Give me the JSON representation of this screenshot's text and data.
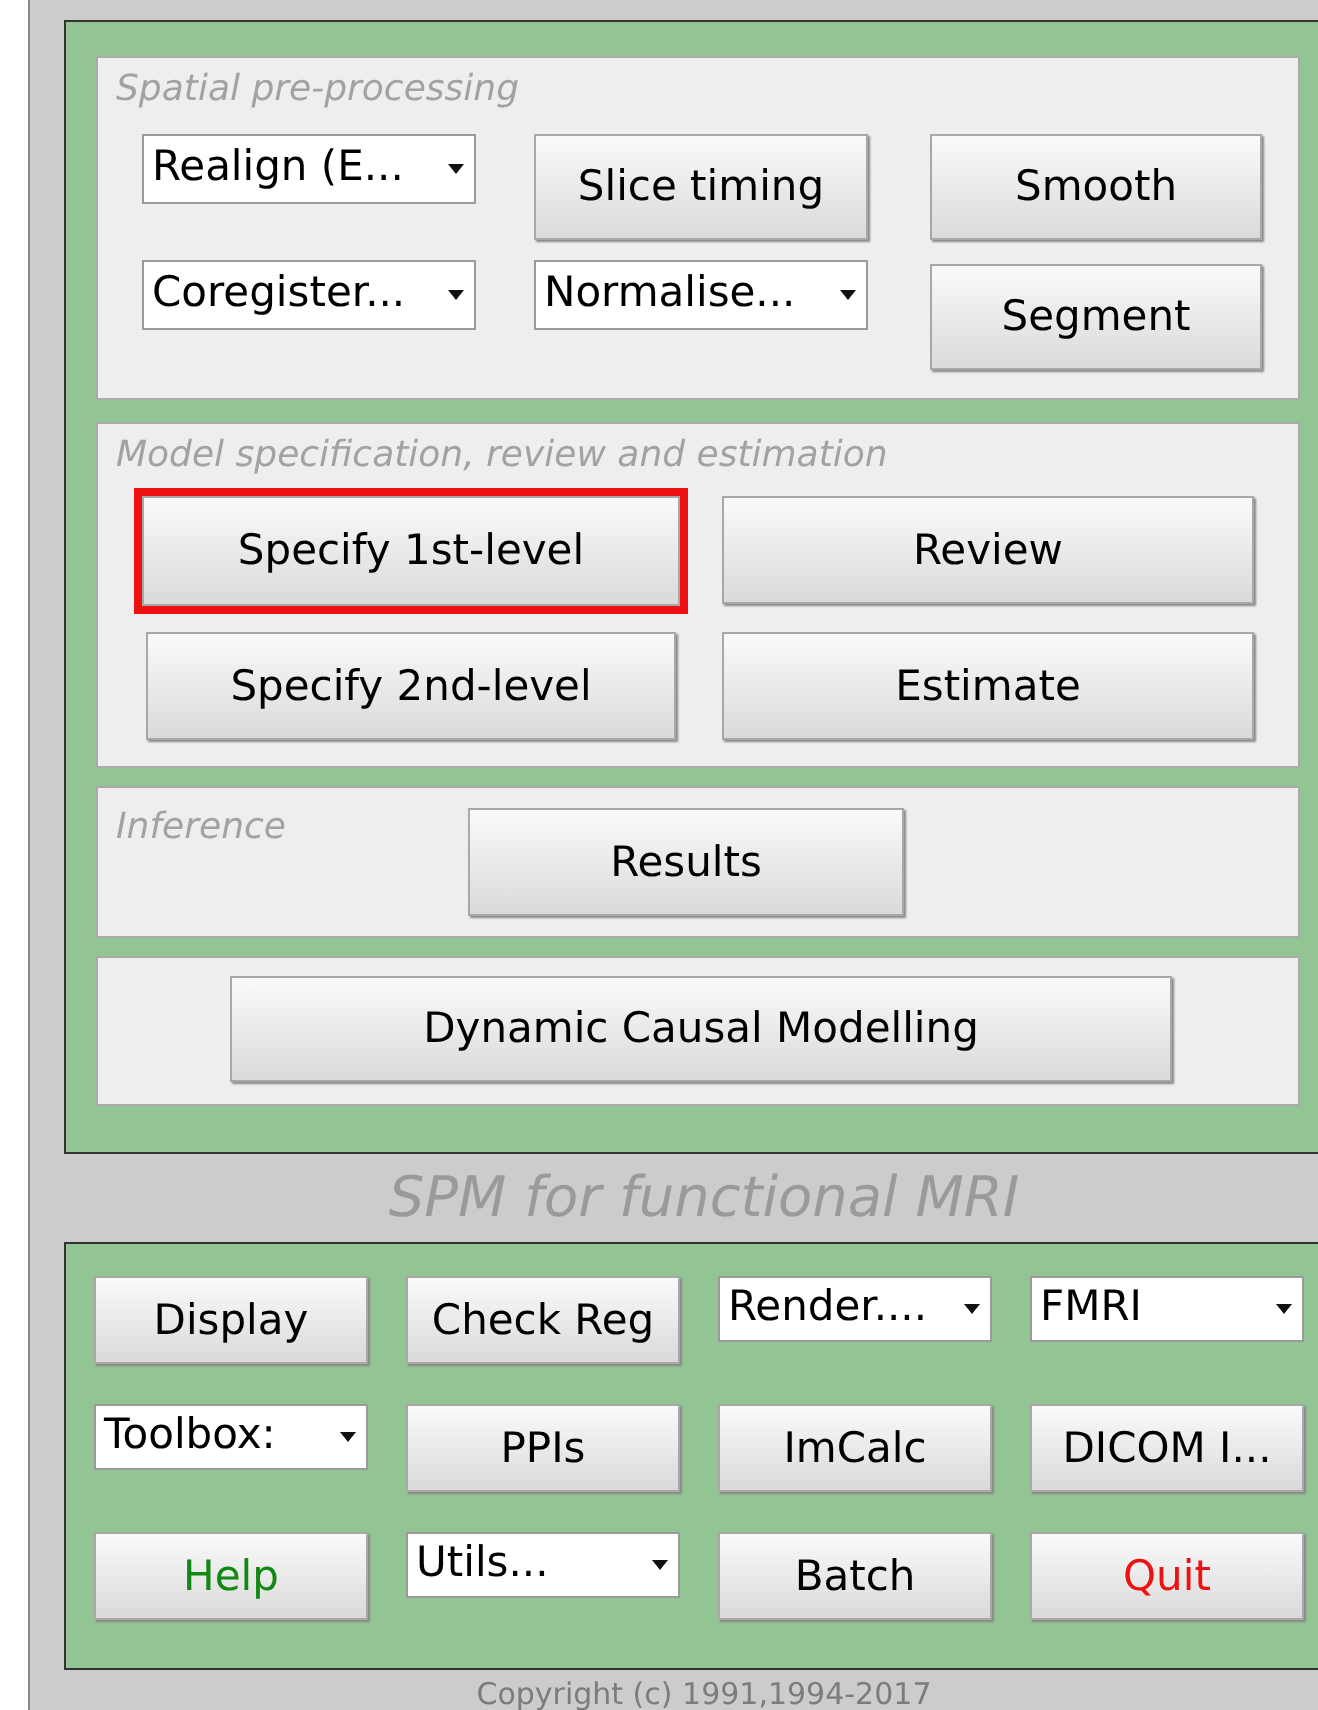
{
  "top_panel": {
    "sections": [
      {
        "title": "Spatial pre-processing",
        "controls": [
          {
            "kind": "dropdown",
            "label": "Realign (E...",
            "highlighted": false
          },
          {
            "kind": "button",
            "label": "Slice timing",
            "highlighted": false
          },
          {
            "kind": "button",
            "label": "Smooth",
            "highlighted": false
          },
          {
            "kind": "dropdown",
            "label": "Coregister...",
            "highlighted": false
          },
          {
            "kind": "dropdown",
            "label": "Normalise...",
            "highlighted": false
          },
          {
            "kind": "button",
            "label": "Segment",
            "highlighted": false
          }
        ]
      },
      {
        "title": "Model specification, review and estimation",
        "controls": [
          {
            "kind": "button",
            "label": "Specify 1st-level",
            "highlighted": true
          },
          {
            "kind": "button",
            "label": "Review",
            "highlighted": false
          },
          {
            "kind": "button",
            "label": "Specify 2nd-level",
            "highlighted": false
          },
          {
            "kind": "button",
            "label": "Estimate",
            "highlighted": false
          }
        ]
      },
      {
        "title": "Inference",
        "controls": [
          {
            "kind": "button",
            "label": "Results",
            "highlighted": false
          }
        ]
      },
      {
        "controls": [
          {
            "kind": "button",
            "label": "Dynamic Causal Modelling",
            "highlighted": false
          }
        ]
      }
    ]
  },
  "heading": "SPM for functional MRI",
  "bottom_panel": {
    "controls": [
      {
        "kind": "button",
        "label": "Display"
      },
      {
        "kind": "button",
        "label": "Check Reg"
      },
      {
        "kind": "dropdown",
        "label": "Render...."
      },
      {
        "kind": "dropdown",
        "label": "FMRI"
      },
      {
        "kind": "dropdown",
        "label": "Toolbox:"
      },
      {
        "kind": "button",
        "label": "PPIs"
      },
      {
        "kind": "button",
        "label": "ImCalc"
      },
      {
        "kind": "button",
        "label": "DICOM I..."
      },
      {
        "kind": "button",
        "label": "Help",
        "color": "#118811"
      },
      {
        "kind": "dropdown",
        "label": "Utils..."
      },
      {
        "kind": "button",
        "label": "Batch"
      },
      {
        "kind": "button",
        "label": "Quit",
        "color": "#ee1111"
      }
    ]
  },
  "copyright": "Copyright (c) 1991,1994-2017"
}
